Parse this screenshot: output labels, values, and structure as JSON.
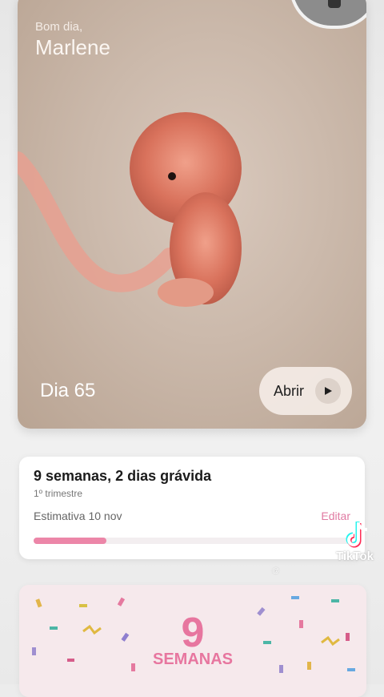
{
  "hero": {
    "greeting": "Bom dia,",
    "name": "Marlene",
    "day_label": "Dia 65",
    "open_button": "Abrir"
  },
  "pregnancy": {
    "title": "9 semanas, 2 dias grávida",
    "trimester": "1º trimestre",
    "estimate": "Estimativa 10 nov",
    "edit": "Editar",
    "progress_fraction": 0.23
  },
  "weeks": {
    "number": "9",
    "label": "SEMANAS"
  },
  "overlay": {
    "tiktok_label": "TikTok",
    "handle": "@"
  },
  "colors": {
    "accent_pink": "#e7769f",
    "progress_pink": "#ec86a8"
  }
}
